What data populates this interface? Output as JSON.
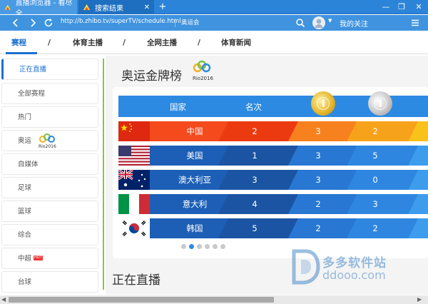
{
  "browser": {
    "tabs": [
      {
        "label": "直播浏览器 - 看尽全...",
        "active": true
      },
      {
        "label": "搜索结果",
        "active": false
      }
    ],
    "url": "http://b.zhibo.tv/superTV/schedule.html",
    "url_tag": "奥运会",
    "follow_label": "我的关注",
    "colors": {
      "titlebar": "#2b84d8",
      "navbar": "#3f93df"
    }
  },
  "site_nav": {
    "tabs": [
      "赛程",
      "体育主播",
      "全网主播",
      "体育新闻"
    ],
    "separator": "/",
    "active_index": 0
  },
  "sidebar": {
    "items": [
      {
        "label": "正在直播",
        "active": true
      },
      {
        "label": "全部赛程"
      },
      {
        "label": "热门"
      },
      {
        "label": "奥运",
        "logo": "rio2016-logo"
      },
      {
        "label": "自媒体"
      },
      {
        "label": "足球"
      },
      {
        "label": "篮球"
      },
      {
        "label": "综合"
      },
      {
        "label": "中超",
        "badge": "HOT"
      },
      {
        "label": "台球"
      }
    ]
  },
  "main": {
    "title": "奥运金牌榜",
    "rio_logo_text": "Rio2016",
    "table": {
      "headers": {
        "country": "国家",
        "rank": "名次"
      },
      "rows": [
        {
          "flag": "china-flag",
          "country": "中国",
          "rank": "2",
          "gold": "3",
          "silver": "2"
        },
        {
          "flag": "usa-flag",
          "country": "美国",
          "rank": "1",
          "gold": "3",
          "silver": "5"
        },
        {
          "flag": "australia-flag",
          "country": "澳大利亚",
          "rank": "3",
          "gold": "3",
          "silver": "0"
        },
        {
          "flag": "italy-flag",
          "country": "意大利",
          "rank": "4",
          "gold": "2",
          "silver": "3"
        },
        {
          "flag": "korea-flag",
          "country": "韩国",
          "rank": "5",
          "gold": "2",
          "silver": "2"
        }
      ]
    },
    "live_title": "正在直播",
    "carousel_active_index": 1,
    "carousel_count": 6
  },
  "watermark": {
    "line1": "多多软件站",
    "line2": "ddooo.com"
  }
}
